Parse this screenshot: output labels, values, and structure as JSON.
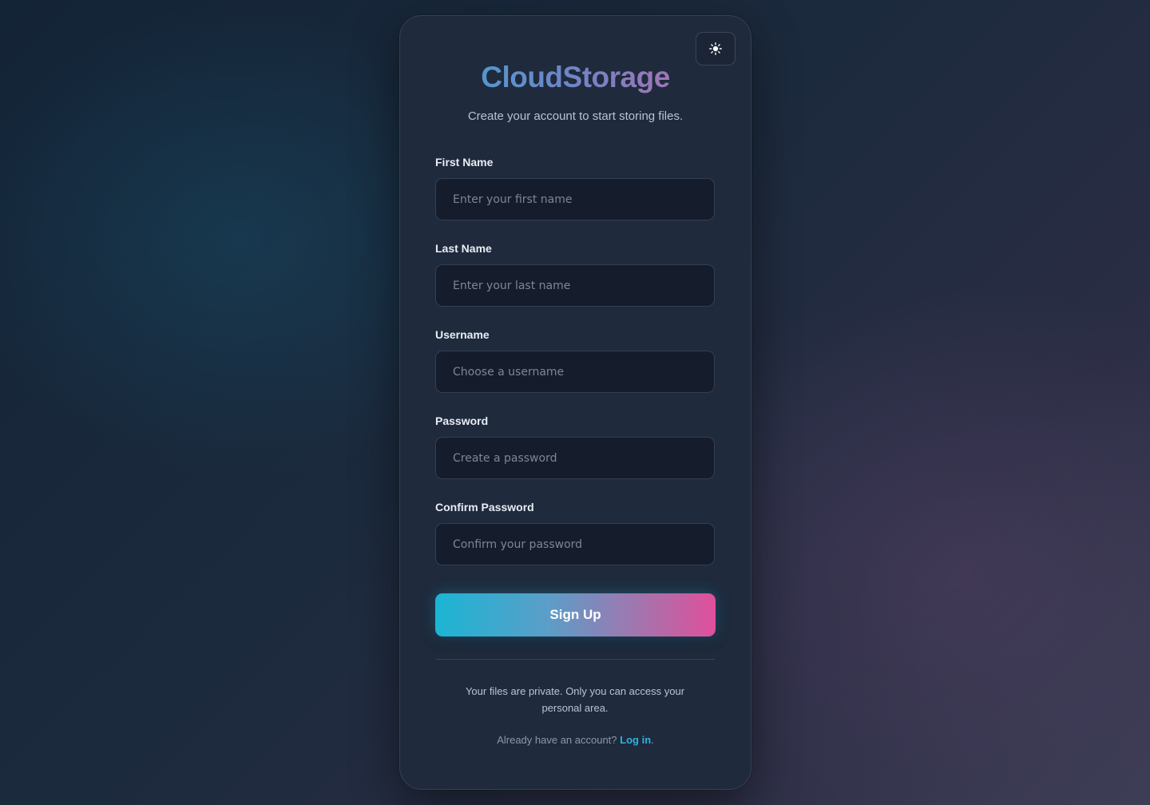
{
  "brand": {
    "name": "CloudStorage",
    "gradient": [
      "#3fa8d2",
      "#c46aa8"
    ]
  },
  "subtitle": "Create your account to start storing files.",
  "theme_toggle": {
    "icon": "sun-icon"
  },
  "form": {
    "fields": [
      {
        "label": "First Name",
        "placeholder": "Enter your first name",
        "value": ""
      },
      {
        "label": "Last Name",
        "placeholder": "Enter your last name",
        "value": ""
      },
      {
        "label": "Username",
        "placeholder": "Choose a username",
        "value": ""
      },
      {
        "label": "Password",
        "placeholder": "Create a password",
        "value": ""
      },
      {
        "label": "Confirm Password",
        "placeholder": "Confirm your password",
        "value": ""
      }
    ],
    "submit_label": "Sign Up"
  },
  "footer": {
    "privacy_note": "Your files are private. Only you can access your personal area.",
    "login_prompt": "Already have an account?",
    "login_link": "Log in",
    "login_suffix": "."
  },
  "colors": {
    "accent_cyan": "#1bb5d4",
    "accent_pink": "#e14f9c",
    "card_bg": "#1f2a3c",
    "link": "#2bb4dd"
  }
}
